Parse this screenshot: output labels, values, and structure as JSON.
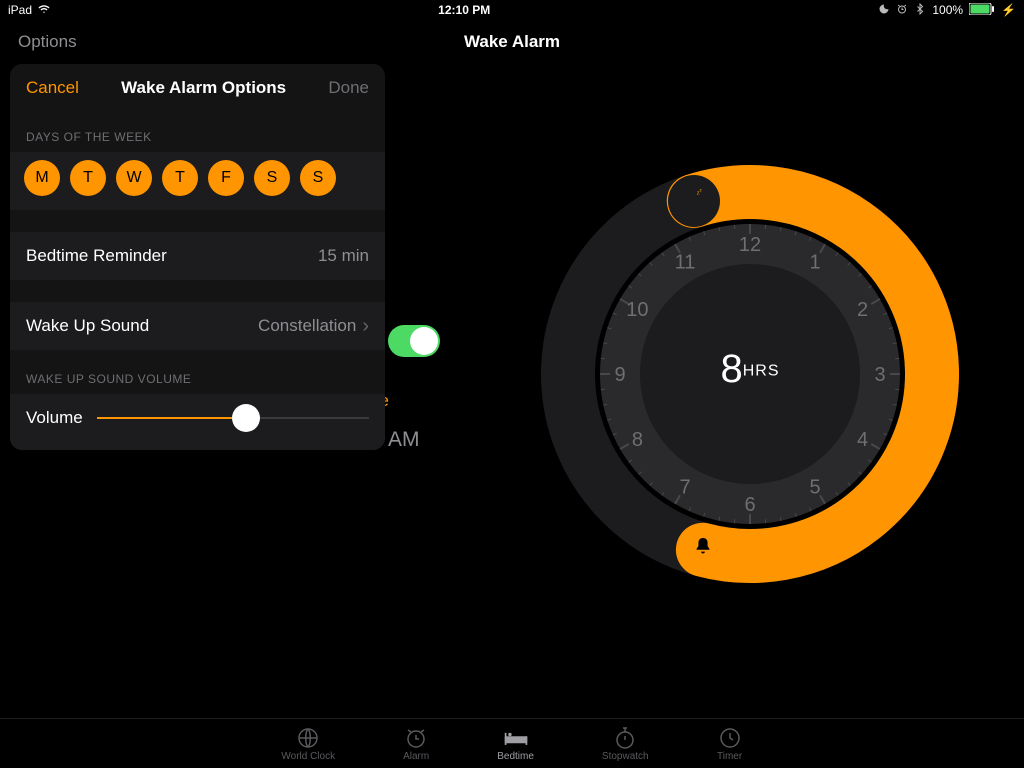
{
  "status": {
    "device": "iPad",
    "time": "12:10 PM",
    "battery_pct": "100%"
  },
  "nav": {
    "left": "Options",
    "title": "Wake Alarm"
  },
  "popover": {
    "cancel": "Cancel",
    "title": "Wake Alarm Options",
    "done": "Done",
    "days_label": "DAYS OF THE WEEK",
    "days": [
      "M",
      "T",
      "W",
      "T",
      "F",
      "S",
      "S"
    ],
    "bedtime_reminder": {
      "label": "Bedtime Reminder",
      "value": "15 min"
    },
    "wake_sound": {
      "label": "Wake Up Sound",
      "value": "Constellation"
    },
    "volume_section_label": "WAKE UP SOUND VOLUME",
    "volume_label": "Volume",
    "volume_pct": 55
  },
  "bg": {
    "wake_label_suffix": "ke",
    "wake_time_suffix": "AM"
  },
  "dial": {
    "duration_value": "8",
    "duration_unit": "HRS",
    "hours": [
      "12",
      "1",
      "2",
      "3",
      "4",
      "5",
      "6",
      "7",
      "8",
      "9",
      "10",
      "11"
    ],
    "arc": {
      "start_deg": -18,
      "end_deg": 195
    }
  },
  "tabs": [
    {
      "label": "World Clock",
      "icon": "globe-icon",
      "active": false
    },
    {
      "label": "Alarm",
      "icon": "alarm-icon",
      "active": false
    },
    {
      "label": "Bedtime",
      "icon": "bed-icon",
      "active": true
    },
    {
      "label": "Stopwatch",
      "icon": "stopwatch-icon",
      "active": false
    },
    {
      "label": "Timer",
      "icon": "timer-icon",
      "active": false
    }
  ]
}
